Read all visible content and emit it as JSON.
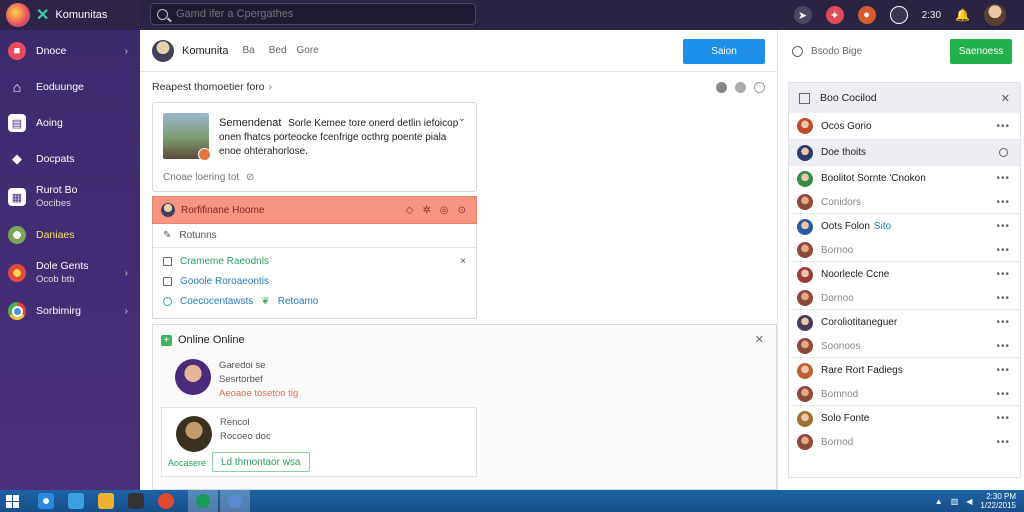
{
  "app": {
    "name": "Komunitas"
  },
  "search": {
    "placeholder": "Gamd ifer a Cpergathes"
  },
  "topbar": {
    "time": "2:30"
  },
  "sidebar": {
    "items": [
      {
        "label": "Dnoce",
        "sub": "",
        "icon": "app-red-icon",
        "chevron": true
      },
      {
        "label": "Eoduunge",
        "sub": "",
        "icon": "home-icon",
        "chevron": false
      },
      {
        "label": "Aoing",
        "sub": "",
        "icon": "inbox-icon",
        "chevron": false
      },
      {
        "label": "Docpats",
        "sub": "",
        "icon": "chat-icon",
        "chevron": false
      },
      {
        "label": "Rurot Bo",
        "sub": "Oocibes",
        "icon": "grid-icon",
        "chevron": false
      },
      {
        "label": "Daniaes",
        "sub": "",
        "icon": "ball-icon",
        "chevron": false
      },
      {
        "label": "Dole Gents",
        "sub": "Ocob btb",
        "icon": "fox-icon",
        "chevron": true
      },
      {
        "label": "Sorbimirg",
        "sub": "",
        "icon": "chrome-icon",
        "chevron": true
      }
    ]
  },
  "main": {
    "title": "Komunita",
    "links": [
      "Ba",
      "Bed",
      "Gore"
    ],
    "primary_button": "Saion",
    "section_title": "Reapest thomoetier foro",
    "card": {
      "title": "Semendenat",
      "body": "Sorle Kemee tore onerd detlin iefoicop onen fhatcs porteocke fcenfrige octhrg poente piala enoe ohterahorlose.",
      "footer": "Cnoae loering tot"
    },
    "alert": {
      "text": "Rorfifinane Hoome"
    },
    "list": {
      "header": "Rotunns",
      "rows": [
        {
          "label": "Crameme Raeodnls",
          "color": "green"
        },
        {
          "label": "Gooole Roroaeontis",
          "color": "blue"
        },
        {
          "label": "Coecocentawsts",
          "extra": "Retoamo",
          "color": "green"
        }
      ]
    },
    "online": {
      "title": "Online Online",
      "items": [
        {
          "name": "Garedoi se",
          "status": "Sesrtorbef",
          "meta": "Aeoaoe tosetoo tig"
        },
        {
          "name": "Rencol",
          "status": "Rocoeo doc",
          "button": "Ld thmontaor wsa",
          "tag": "Aocasere"
        }
      ]
    }
  },
  "right": {
    "header_label": "Bsodo Bige",
    "primary_button": "Saenoess",
    "panel_title": "Boo Cocilod",
    "items": [
      {
        "name": "Ocos Gorio",
        "sub": "",
        "highlight": false,
        "avatar": "#c04a2a"
      },
      {
        "name": "Doe thoits",
        "sub": "",
        "highlight": true,
        "avatar": "#2a3a6a"
      },
      {
        "name": "Boolitot Sornte 'Cnokon",
        "sub": "Conidors",
        "highlight": false,
        "avatar": "#3a8a4a"
      },
      {
        "name": "Oots Folon",
        "sub": "Bornoo",
        "tag": "Sito",
        "highlight": false,
        "avatar": "#2a5aa0"
      },
      {
        "name": "Noorlecle Ccne",
        "sub": "Dornoo",
        "highlight": false,
        "avatar": "#a03a3a"
      },
      {
        "name": "Coroliotitaneguer",
        "sub": "Soonoos",
        "highlight": false,
        "avatar": "#4a3a5a"
      },
      {
        "name": "Rare Rort Fadiegs",
        "sub": "Bomnod",
        "highlight": false,
        "avatar": "#c06030"
      },
      {
        "name": "Solo Fonte",
        "sub": "Bornod",
        "highlight": false,
        "avatar": "#a07030"
      }
    ]
  },
  "taskbar": {
    "clock_time": "2:30 PM",
    "clock_date": "1/22/2015"
  },
  "colors": {
    "accent": "#1e8fe8",
    "green": "#22b04a",
    "sidebar": "#3c2a6e",
    "alert": "#f79581"
  }
}
